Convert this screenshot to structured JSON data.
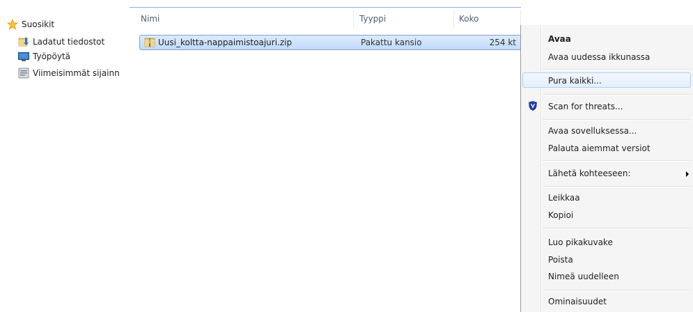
{
  "nav": {
    "favorites": "Suosikit",
    "downloads": "Ladatut tiedostot",
    "desktop": "Työpöytä",
    "recent": "Viimeisimmät sijainn"
  },
  "columns": {
    "name": "Nimi",
    "type": "Tyyppi",
    "size": "Koko"
  },
  "file": {
    "name": "Uusi_koltta-nappaimistoajuri.zip",
    "type": "Pakattu kansio",
    "size": "254 kt"
  },
  "menu": {
    "open": "Avaa",
    "open_new_window": "Avaa uudessa ikkunassa",
    "extract_all": "Pura kaikki...",
    "scan": "Scan for threats...",
    "open_with": "Avaa sovelluksessa...",
    "restore_previous": "Palauta aiemmat versiot",
    "send_to": "Lähetä kohteeseen:",
    "cut": "Leikkaa",
    "copy": "Kopioi",
    "create_shortcut": "Luo pikakuvake",
    "delete": "Poista",
    "rename": "Nimeä uudelleen",
    "properties": "Ominaisuudet"
  },
  "colors": {
    "selection": "#c1dbfc",
    "menu_bg": "#f5f5f5",
    "header_text": "#4c607a"
  },
  "icons": [
    "star-icon",
    "downloads-folder-icon",
    "desktop-icon",
    "recent-places-icon",
    "zip-folder-icon",
    "shield-icon",
    "submenu-arrow-icon"
  ]
}
